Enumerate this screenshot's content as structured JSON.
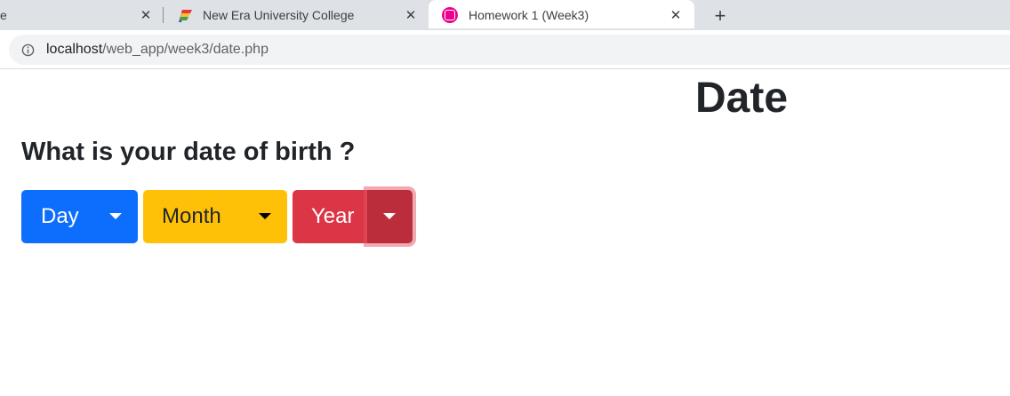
{
  "browser": {
    "tabs": [
      {
        "title": "e",
        "favicon": ""
      },
      {
        "title": "New Era University College",
        "favicon": "rainbow-flag-icon"
      },
      {
        "title": "Homework 1 (Week3)",
        "favicon": "wamp-icon",
        "active": true
      }
    ],
    "close_glyph": "✕",
    "new_tab_glyph": "+",
    "url_host": "localhost",
    "url_path": "/web_app/week3/date.php"
  },
  "page": {
    "title": "Date",
    "question": "What is your date of birth ?",
    "dropdowns": {
      "day": "Day",
      "month": "Month",
      "year": "Year"
    }
  },
  "colors": {
    "day": "#0d6efd",
    "month": "#ffc107",
    "year": "#dc3545",
    "year_toggle": "#bb2d3b"
  }
}
